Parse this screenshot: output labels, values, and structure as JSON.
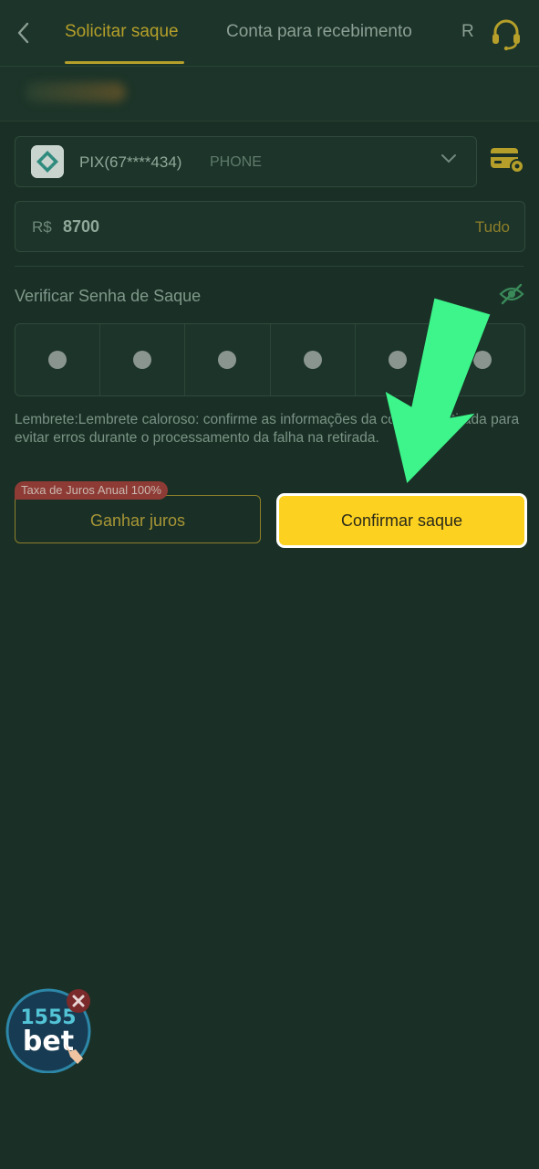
{
  "header": {
    "tabs": [
      {
        "label": "Solicitar saque",
        "active": true
      },
      {
        "label": "Conta para recebimento",
        "active": false
      },
      {
        "label": "R",
        "active": false
      }
    ]
  },
  "account": {
    "name": "PIX(67****434)",
    "type": "PHONE"
  },
  "amount": {
    "currency": "R$",
    "value": "8700",
    "all_label": "Tudo"
  },
  "password": {
    "label": "Verificar Senha de Saque",
    "digits_filled": 6
  },
  "reminder": "Lembrete:Lembrete caloroso: confirme as informações da conta de retirada para evitar erros durante o processamento da falha na retirada.",
  "actions": {
    "interest_badge": "Taxa de Juros Anual 100%",
    "interest_label": "Ganhar juros",
    "confirm_label": "Confirmar saque"
  },
  "floating_logo": {
    "brand_number": "1555",
    "brand_word": "bet"
  },
  "colors": {
    "accent": "#b59f2a",
    "confirm": "#fcd11f",
    "arrow": "#3df58a",
    "badge": "#8e3b35"
  }
}
